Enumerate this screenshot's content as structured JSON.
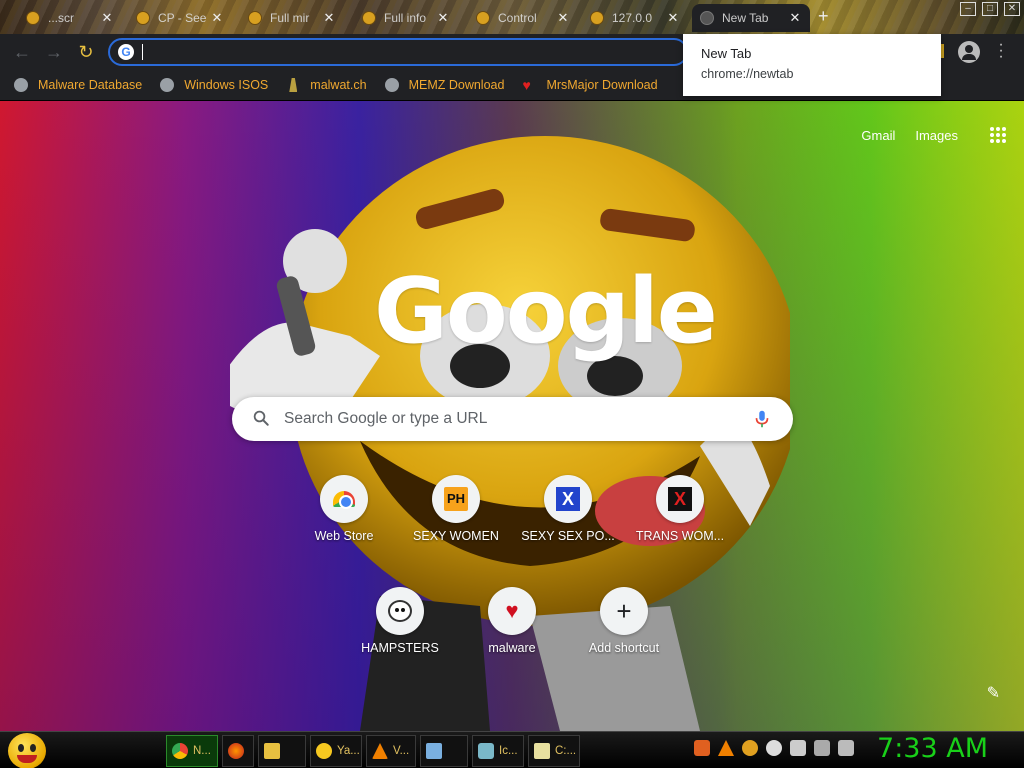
{
  "tabs": [
    {
      "title": "...scr"
    },
    {
      "title": "CP - See"
    },
    {
      "title": "Full mir"
    },
    {
      "title": "Full info"
    },
    {
      "title": "Control"
    },
    {
      "title": "127.0.0"
    },
    {
      "title": "New Tab",
      "active": true
    }
  ],
  "toolbar": {
    "omnibox_value": "",
    "omnibox_icon": "google-g-icon"
  },
  "bookmarks": [
    {
      "label": "Malware Database",
      "icon": "globe-icon"
    },
    {
      "label": "Windows ISOS",
      "icon": "globe-icon"
    },
    {
      "label": "malwat.ch",
      "icon": "tower-icon"
    },
    {
      "label": "MEMZ Download",
      "icon": "globe-icon"
    },
    {
      "label": "MrsMajor Download",
      "icon": "heart-icon"
    }
  ],
  "tooltip": {
    "title": "New Tab",
    "url": "chrome://newtab"
  },
  "ntp": {
    "links": {
      "gmail": "Gmail",
      "images": "Images"
    },
    "logo": "Google",
    "search_placeholder": "Search Google or type a URL",
    "shortcuts": [
      {
        "label": "Web Store",
        "icon": "web-store-icon"
      },
      {
        "label": "SEXY WOMEN",
        "icon": "ph-icon"
      },
      {
        "label": "SEXY SEX PO...",
        "icon": "x-blue-icon"
      },
      {
        "label": "TRANS WOM...",
        "icon": "x-red-icon"
      },
      {
        "label": "HAMPSTERS",
        "icon": "hamster-icon"
      },
      {
        "label": "malware",
        "icon": "heart-icon"
      },
      {
        "label": "Add shortcut",
        "icon": "plus-icon"
      }
    ]
  },
  "taskbar": {
    "buttons": [
      {
        "label": "N...",
        "icon": "chrome-icon",
        "active": true
      },
      {
        "label": "",
        "icon": "firefox-icon"
      },
      {
        "label": "",
        "icon": "folder-icon"
      },
      {
        "label": "Ya...",
        "icon": "smiley-icon"
      },
      {
        "label": "V...",
        "icon": "vlc-icon"
      },
      {
        "label": "",
        "icon": "notepad-icon"
      },
      {
        "label": "Ic...",
        "icon": "bottle-icon"
      },
      {
        "label": "C:...",
        "icon": "file-icon"
      }
    ],
    "clock": "7:33 AM"
  },
  "colors": {
    "accent_bookmark": "#f0a830",
    "clock_green": "#19d019",
    "omnibox_focus": "#2a6ad8"
  }
}
